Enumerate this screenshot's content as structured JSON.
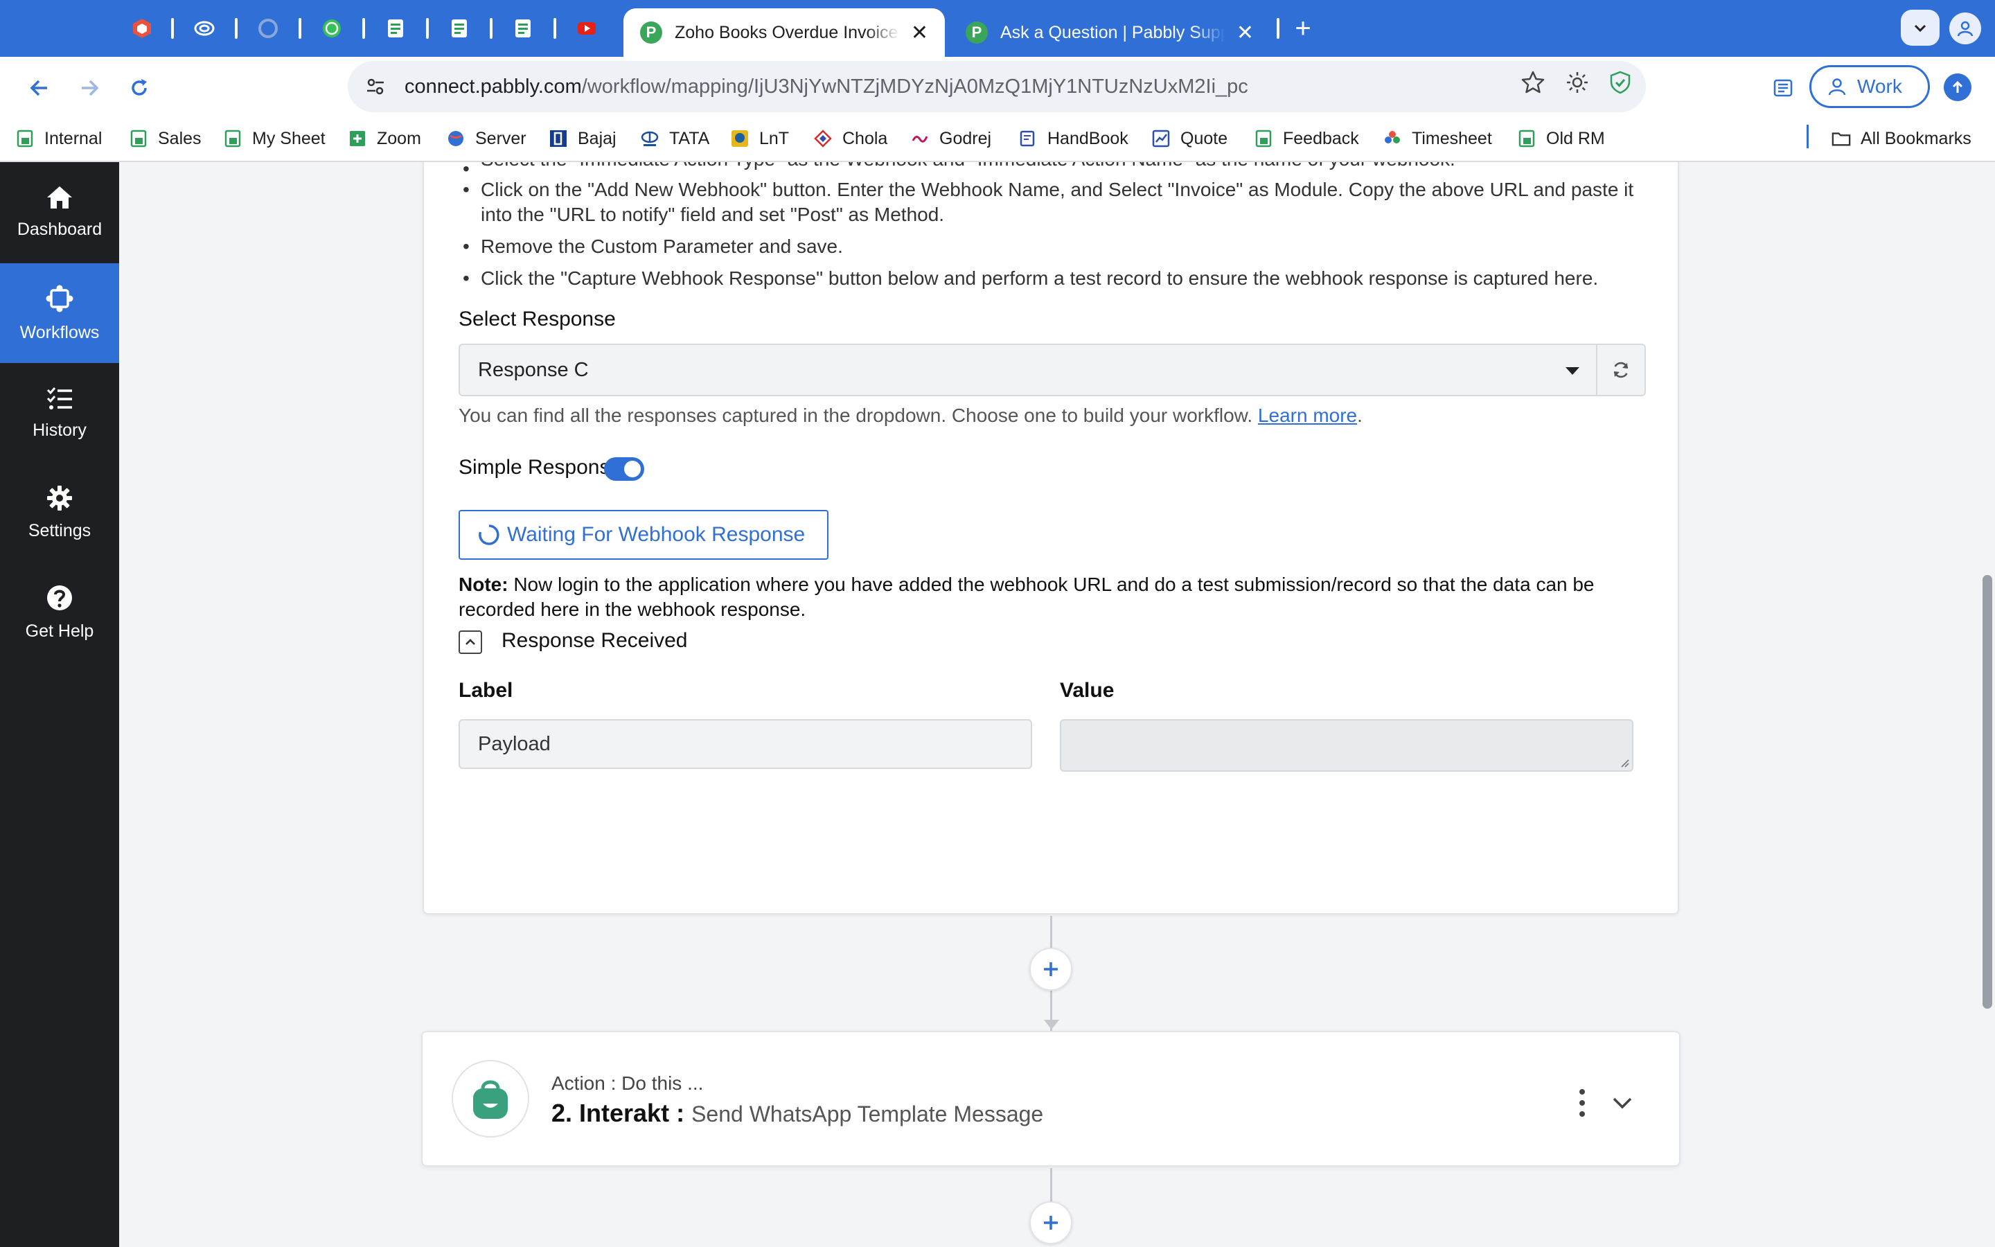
{
  "browser": {
    "tabs": [
      {
        "title": "Zoho Books Overdue Invoice Reminder",
        "active": true
      },
      {
        "title": "Ask a Question | Pabbly Support",
        "active": false
      }
    ],
    "close_glyph": "✕",
    "new_tab_glyph": "+",
    "url_host": "connect.pabbly.com",
    "url_path": "/workflow/mapping/IjU3NjYwNTZjMDYzNjA0MzQ1MjY1NTUzNzUxM2Ii_pc",
    "profile_label": "Work",
    "accent_color": "#2f6fd6"
  },
  "bookmarks": {
    "items": [
      "Internal",
      "Sales",
      "My Sheet",
      "Zoom",
      "Server",
      "Bajaj",
      "TATA",
      "LnT",
      "Chola",
      "Godrej",
      "HandBook",
      "Quote",
      "Feedback",
      "Timesheet",
      "Old RM"
    ],
    "all_bookmarks": "All Bookmarks"
  },
  "sidebar": {
    "items": [
      {
        "label": "Dashboard",
        "icon": "home-icon"
      },
      {
        "label": "Workflows",
        "icon": "workflow-icon"
      },
      {
        "label": "History",
        "icon": "history-list-icon"
      },
      {
        "label": "Settings",
        "icon": "gear-icon"
      },
      {
        "label": "Get Help",
        "icon": "question-icon"
      }
    ],
    "active": "Workflows"
  },
  "trigger": {
    "instructions": [
      "Select the \"Immediate Action Type\" as the Webhook and \"Immediate Action Name\" as the name of your webhook.",
      "Click on the \"Add New Webhook\" button. Enter the Webhook Name, and Select \"Invoice\" as Module. Copy the above URL and paste it into the \"URL to notify\" field and set \"Post\" as Method.",
      "Remove the Custom Parameter and save.",
      "Click the \"Capture Webhook Response\" button below and perform a test record to ensure the webhook response is captured here."
    ],
    "select_response_label": "Select Response",
    "select_response_value": "Response C",
    "help_text": "You can find all the responses captured in the dropdown. Choose one to build your workflow. ",
    "help_link": "Learn more",
    "help_suffix": ".",
    "simple_response_label": "Simple Response",
    "simple_response_on": true,
    "waiting_button": "Waiting For Webhook Response",
    "note_label": "Note:",
    "note_text": " Now login to the application where you have added the webhook URL and do a test submission/record so that the data can be recorded here in the webhook response.",
    "response_received_label": "Response Received",
    "label_header": "Label",
    "value_header": "Value",
    "label_field_value": "Payload",
    "value_field_value": ""
  },
  "action": {
    "kind": "Action : Do this ...",
    "title": "2. Interakt : ",
    "event": "Send WhatsApp Template Message",
    "app_color": "#3aa17e"
  }
}
